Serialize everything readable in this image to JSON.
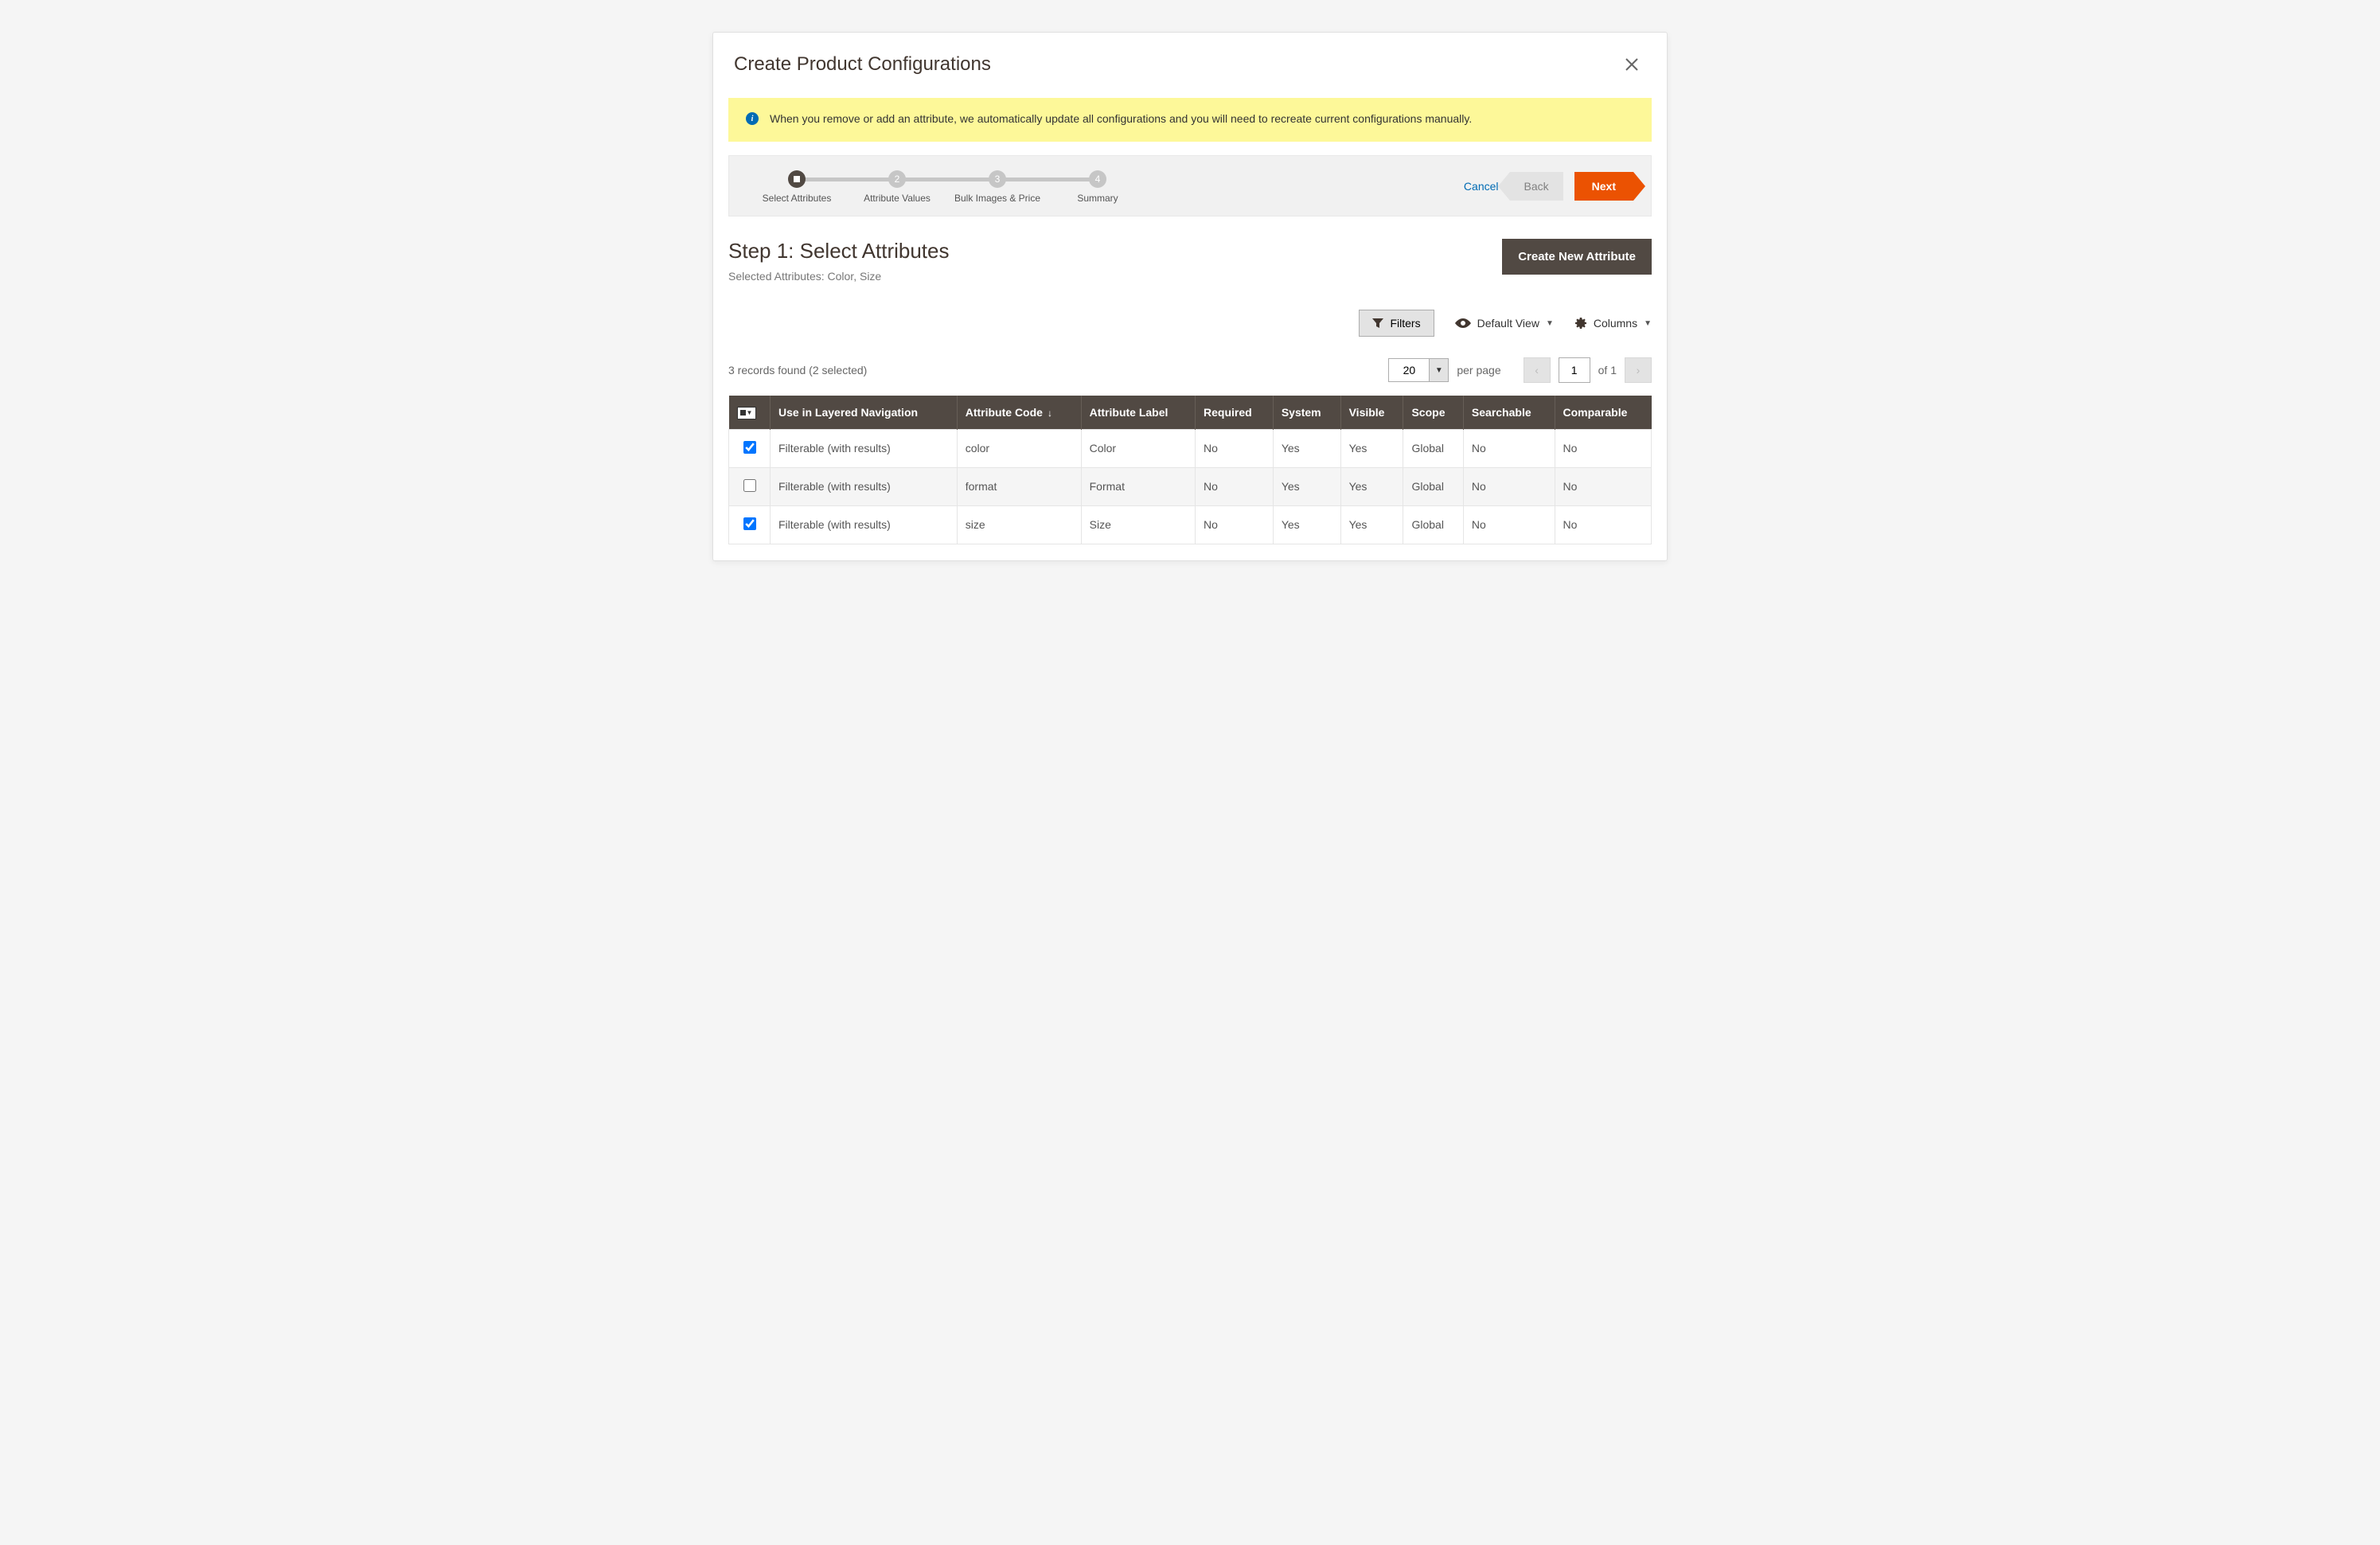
{
  "modal": {
    "title": "Create Product Configurations",
    "notice": "When you remove or add an attribute, we automatically update all configurations and you will need to recreate current configurations manually."
  },
  "wizard": {
    "steps": [
      {
        "num": "",
        "label": "Select Attributes",
        "active": true
      },
      {
        "num": "2",
        "label": "Attribute Values",
        "active": false
      },
      {
        "num": "3",
        "label": "Bulk Images & Price",
        "active": false
      },
      {
        "num": "4",
        "label": "Summary",
        "active": false
      }
    ],
    "cancel": "Cancel",
    "back": "Back",
    "next": "Next"
  },
  "step_panel": {
    "title": "Step 1: Select Attributes",
    "selected_label": "Selected Attributes: Color, Size",
    "create_button": "Create New Attribute"
  },
  "toolbar": {
    "filters": "Filters",
    "default_view": "Default View",
    "columns": "Columns"
  },
  "grid_meta": {
    "records_found": "3 records found (2 selected)",
    "page_size": "20",
    "per_page": "per page",
    "current_page": "1",
    "total_pages": "of 1"
  },
  "columns": {
    "layered": "Use in Layered Navigation",
    "code": "Attribute Code",
    "label": "Attribute Label",
    "required": "Required",
    "system": "System",
    "visible": "Visible",
    "scope": "Scope",
    "searchable": "Searchable",
    "comparable": "Comparable"
  },
  "rows": [
    {
      "checked": true,
      "layered": "Filterable (with results)",
      "code": "color",
      "label": "Color",
      "required": "No",
      "system": "Yes",
      "visible": "Yes",
      "scope": "Global",
      "searchable": "No",
      "comparable": "No"
    },
    {
      "checked": false,
      "layered": "Filterable (with results)",
      "code": "format",
      "label": "Format",
      "required": "No",
      "system": "Yes",
      "visible": "Yes",
      "scope": "Global",
      "searchable": "No",
      "comparable": "No"
    },
    {
      "checked": true,
      "layered": "Filterable (with results)",
      "code": "size",
      "label": "Size",
      "required": "No",
      "system": "Yes",
      "visible": "Yes",
      "scope": "Global",
      "searchable": "No",
      "comparable": "No"
    }
  ]
}
